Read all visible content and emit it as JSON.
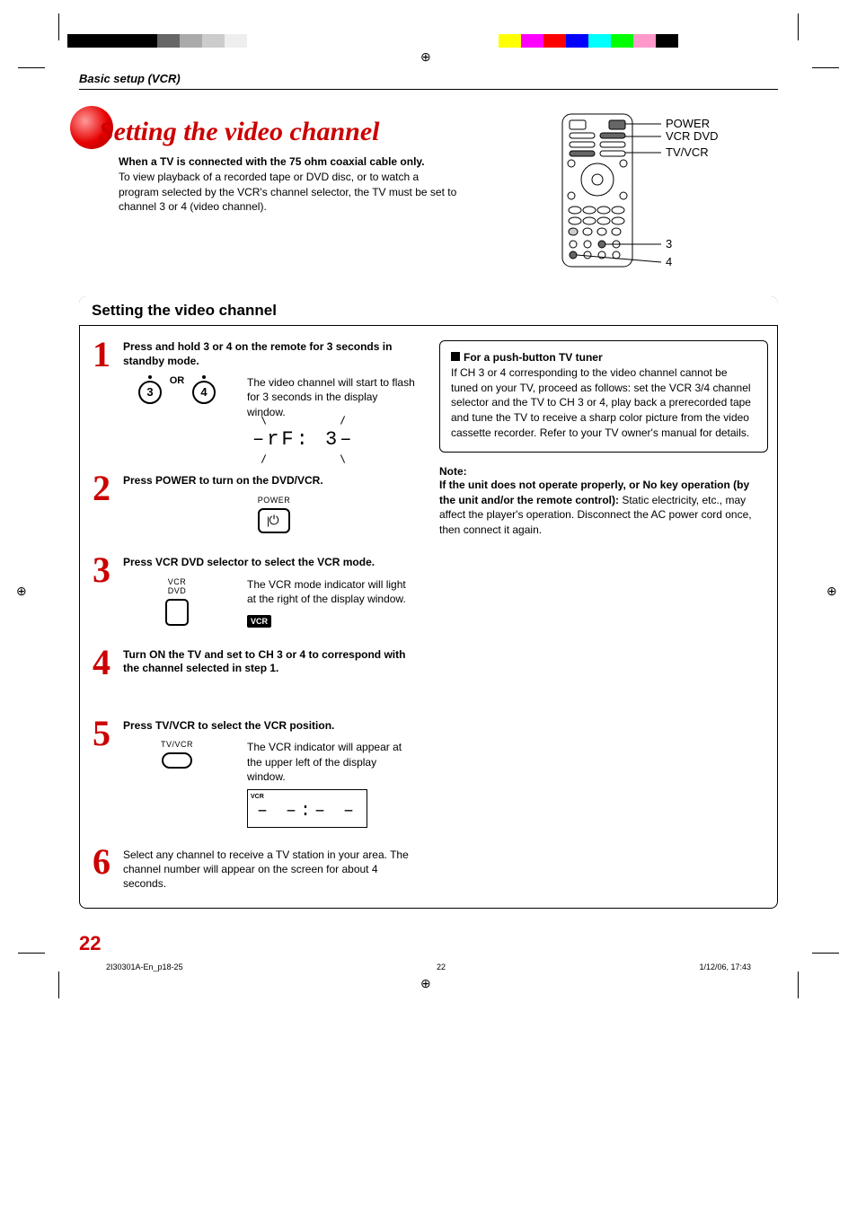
{
  "breadcrumb": "Basic setup (VCR)",
  "title": "Setting the video channel",
  "intro_bold": "When a TV is connected with the 75 ohm coaxial cable only.",
  "intro_text": "To view playback of a recorded tape or DVD disc, or to watch a program selected by the VCR's channel selector, the TV must be set to channel 3 or 4 (video channel).",
  "remote_labels": {
    "power": "POWER",
    "vcrdvd": "VCR DVD",
    "tvvcr": "TV/VCR",
    "btn3": "3",
    "btn4": "4"
  },
  "section_title": "Setting the video channel",
  "steps": [
    {
      "num": "1",
      "heading": "Press and hold 3 or 4 on the remote for 3 seconds in standby mode.",
      "or": "OR",
      "btn_a": "3",
      "btn_b": "4",
      "desc": "The video channel will start to flash for 3 seconds in the display window.",
      "seg": "–rF: 3–"
    },
    {
      "num": "2",
      "heading": "Press POWER to turn on the DVD/VCR.",
      "btn_label": "POWER"
    },
    {
      "num": "3",
      "heading": "Press VCR DVD selector to select the VCR mode.",
      "btn_label": "VCR\nDVD",
      "desc": "The VCR mode indicator will light at the right of the display window.",
      "badge": "VCR"
    },
    {
      "num": "4",
      "heading": "Turn ON the TV and set to CH 3 or 4 to correspond with the channel selected in step 1."
    },
    {
      "num": "5",
      "heading": "Press TV/VCR to select the VCR position.",
      "btn_label": "TV/VCR",
      "desc": "The VCR indicator will appear at the upper left of the display window.",
      "disp_tag": "VCR",
      "disp_seg": "– –:– –"
    },
    {
      "num": "6",
      "heading": "Select any channel to receive a TV station in your area. The channel number will appear on the screen for about 4 seconds."
    }
  ],
  "pushbox": {
    "heading": "For a push-button TV tuner",
    "body": "If CH 3 or 4 corresponding to the video channel cannot be tuned on your TV, proceed as follows: set the VCR 3/4 channel selector and the TV to CH 3 or 4, play back a prerecorded tape and tune the TV to receive a sharp color picture from the video cassette recorder. Refer to your TV owner's manual for details."
  },
  "note": {
    "label": "Note:",
    "bold": "If the unit does not operate properly, or No key operation (by the unit and/or the remote control):",
    "rest": " Static electricity, etc., may affect the player's operation. Disconnect the AC power cord once, then connect it again."
  },
  "page_number": "22",
  "footer_left": "2I30301A-En_p18-25",
  "footer_mid": "22",
  "footer_right": "1/12/06, 17:43"
}
